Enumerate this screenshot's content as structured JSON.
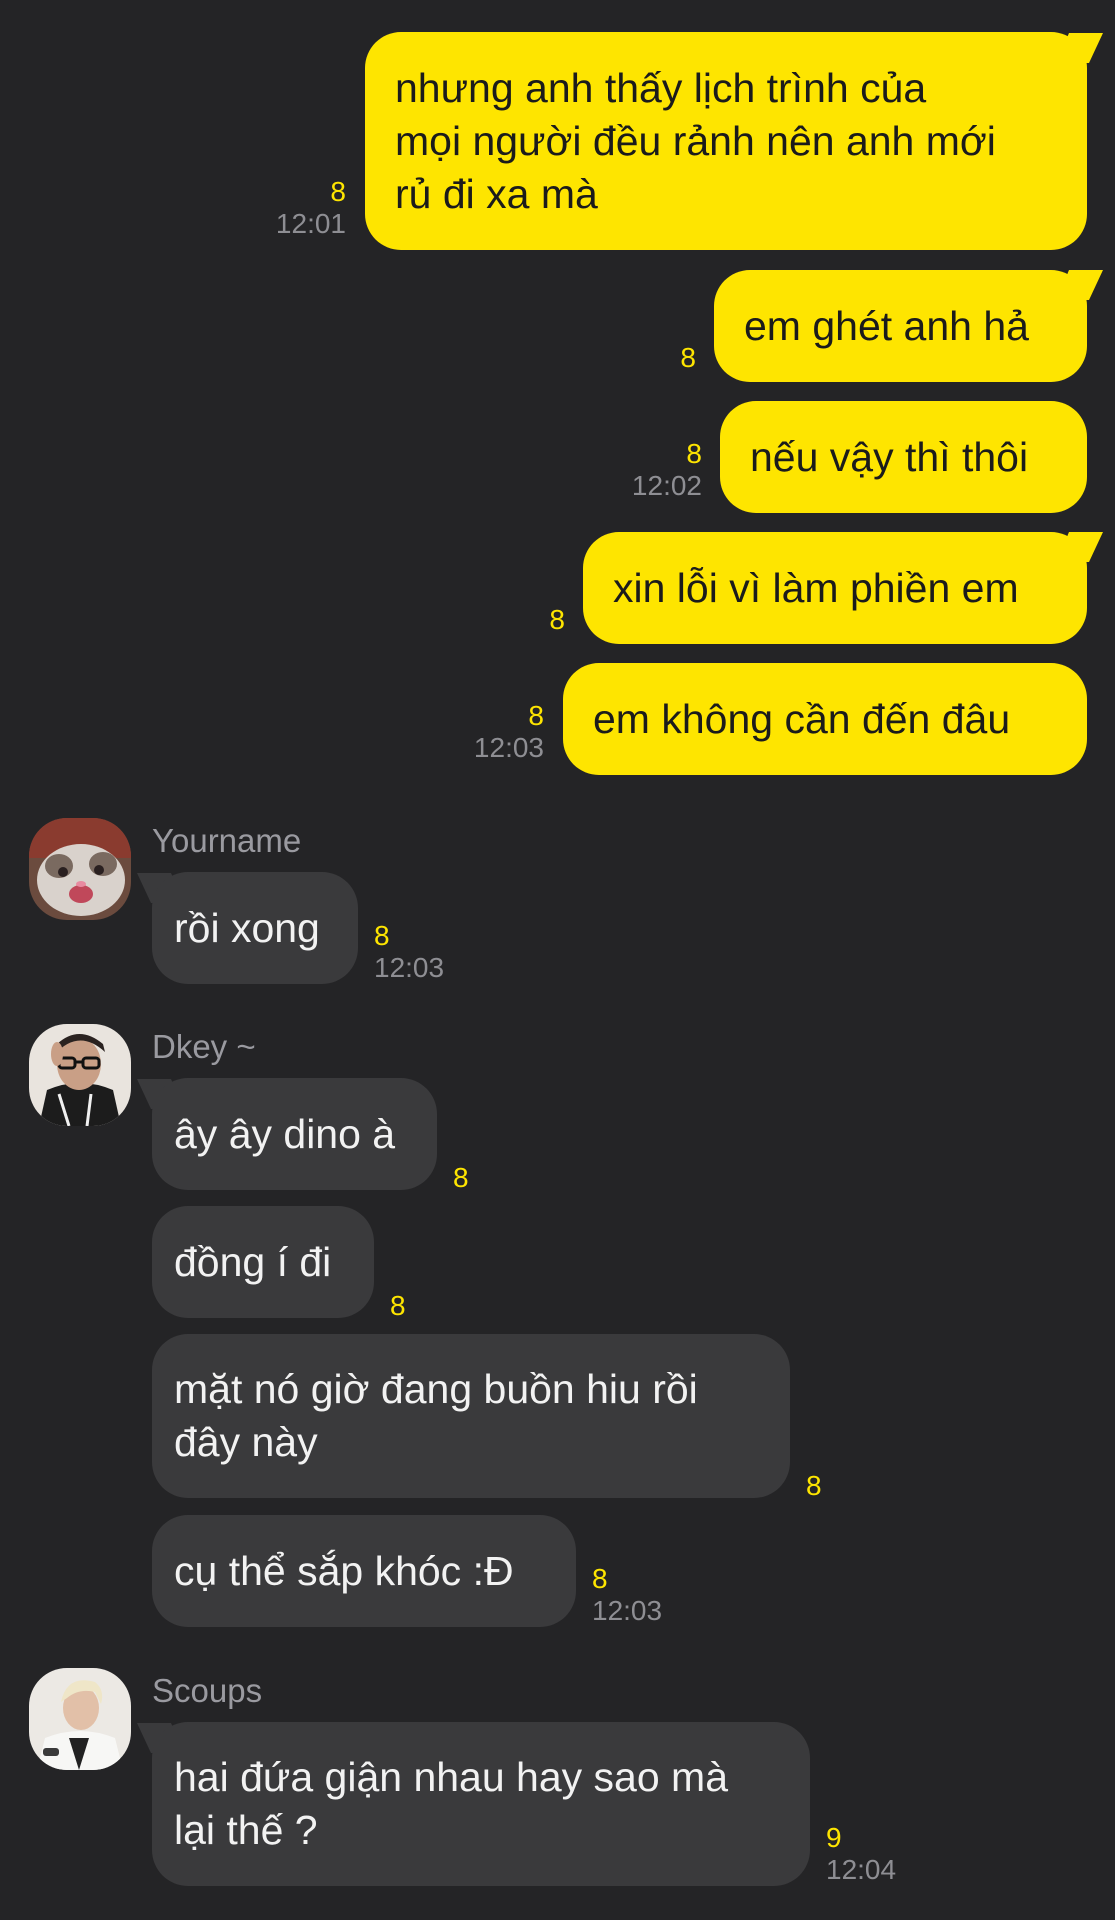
{
  "messages_mine": [
    {
      "text": "nhưng anh thấy lịch trình của\nmọi người đều rảnh nên anh mới\nrủ đi xa mà",
      "unread": "8",
      "time": "12:01"
    },
    {
      "text": "em ghét anh hả",
      "unread": "8",
      "time": ""
    },
    {
      "text": "nếu vậy thì thôi",
      "unread": "8",
      "time": "12:02"
    },
    {
      "text": "xin lỗi vì làm phiền em",
      "unread": "8",
      "time": ""
    },
    {
      "text": "em không cần đến đâu",
      "unread": "8",
      "time": "12:03"
    }
  ],
  "groups": [
    {
      "sender": "Yourname",
      "avatar_icon": "cat-avatar-icon",
      "messages": [
        {
          "text": "rồi xong",
          "unread": "8",
          "time": "12:03"
        }
      ]
    },
    {
      "sender": "Dkey ~",
      "avatar_icon": "person-glasses-avatar-icon",
      "messages": [
        {
          "text": "ây ây dino à",
          "unread": "8",
          "time": ""
        },
        {
          "text": "đồng í đi",
          "unread": "8",
          "time": ""
        },
        {
          "text": "mặt nó giờ đang buồn hiu rồi\nđây này",
          "unread": "8",
          "time": ""
        },
        {
          "text": "cụ thể sắp khóc :Đ",
          "unread": "8",
          "time": "12:03"
        }
      ]
    },
    {
      "sender": "Scoups",
      "avatar_icon": "blond-person-avatar-icon",
      "messages": [
        {
          "text": "hai đứa giận nhau hay sao mà\nlại thế ?",
          "unread": "9",
          "time": "12:04"
        }
      ]
    }
  ],
  "colors": {
    "background": "#242426",
    "my_bubble": "#FEE500",
    "their_bubble": "#3a3a3c",
    "unread_count": "#FEE500",
    "timestamp": "#8e8e93"
  }
}
